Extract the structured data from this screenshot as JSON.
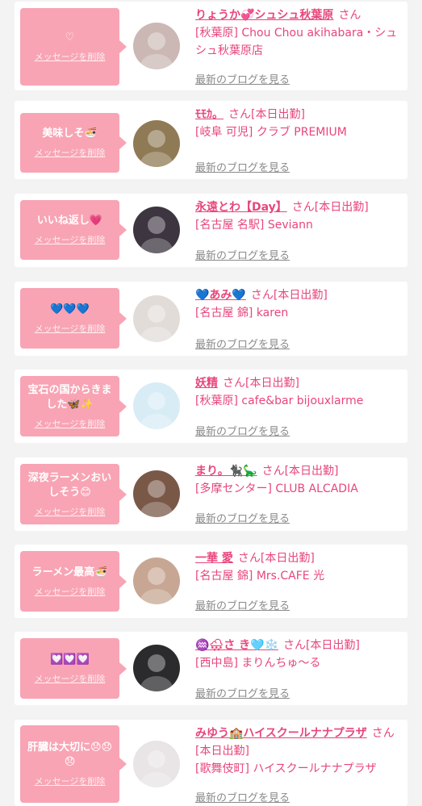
{
  "blog_link_label": "最新のブログを見る",
  "delete_label": "メッセージを削除",
  "san": "さん",
  "entries": [
    {
      "message": "♡",
      "name": "りょうか💞シュシュ秋葉原",
      "status": "",
      "shop": "[秋葉原] Chou Chou akihabara・シュシュ秋葉原店",
      "avatar_color": "#cbb8b4"
    },
    {
      "message": "美味しそ🍜",
      "name": "ﾓﾓｶ。",
      "status": "[本日出勤]",
      "shop": "[岐阜 可児] クラブ PREMIUM",
      "avatar_color": "#8f7a55"
    },
    {
      "message": "いいね返し💗",
      "name": "永遠とわ【Day】",
      "status": "[本日出勤]",
      "shop": "[名古屋 名駅] Seviann",
      "avatar_color": "#3d3540"
    },
    {
      "message": "💙💙💙",
      "name": "💙あみ💙",
      "status": "[本日出勤]",
      "shop": "[名古屋 錦] karen",
      "avatar_color": "#e2dcd8"
    },
    {
      "message": "宝石の国からきました🦋✨",
      "name": "妖精",
      "status": "[本日出勤]",
      "shop": "[秋葉原] cafe&bar bijouxlarme",
      "avatar_color": "#d8ecf6"
    },
    {
      "message": "深夜ラーメンおいしそう😊",
      "name": "まり。🐈‍⬛🦕",
      "status": "[本日出勤]",
      "shop": "[多摩センター] CLUB ALCADIA",
      "avatar_color": "#7a5848"
    },
    {
      "message": "ラーメン最高🍜",
      "name": "一華 愛",
      "status": "[本日出勤]",
      "shop": "[名古屋 錦] Mrs.CAFE 光",
      "avatar_color": "#c7a793"
    },
    {
      "message": "💟💟💟",
      "name": "♒️🌨さ き🩵❄️",
      "status": "[本日出勤]",
      "shop": "[西中島] まりんちゅ～る",
      "avatar_color": "#2b2b2e"
    },
    {
      "message": "肝臓は大切に😞😞😞",
      "name": "みゆう🏫ハイスクールナナプラザ",
      "status": "[本日出勤]",
      "shop": "[歌舞伎町] ハイスクールナナプラザ",
      "avatar_color": "#e9e4e6"
    }
  ]
}
